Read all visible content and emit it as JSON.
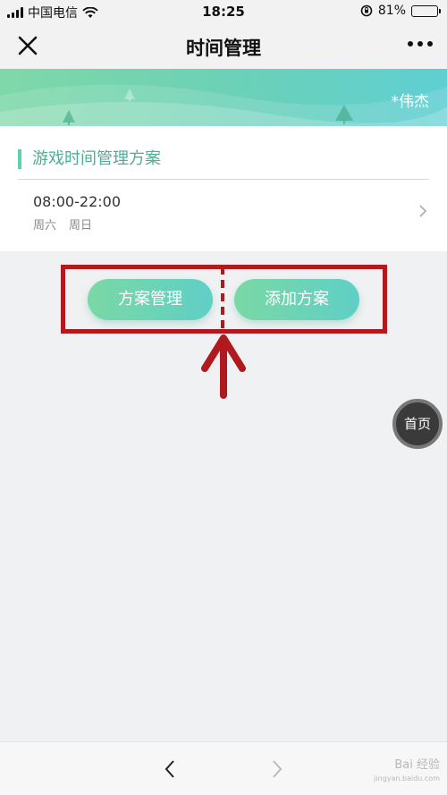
{
  "status_bar": {
    "carrier": "中国电信",
    "time": "18:25",
    "battery": "81%",
    "battery_level": 0.81,
    "icons": [
      "signal-icon",
      "wifi-icon",
      "rotation-lock-icon",
      "battery-icon"
    ]
  },
  "nav": {
    "title": "时间管理",
    "close_icon": "close-icon",
    "more_icon": "more-icon"
  },
  "banner": {
    "user": "*伟杰"
  },
  "section": {
    "title": "游戏时间管理方案"
  },
  "plans": [
    {
      "time": "08:00-22:00",
      "days": [
        "周六",
        "周日"
      ]
    }
  ],
  "buttons": {
    "manage": "方案管理",
    "add": "添加方案"
  },
  "fab": {
    "home": "首页"
  },
  "watermark": {
    "line1": "Bai 经验",
    "line2": "jingyan.baidu.com"
  },
  "colors": {
    "accent": "#5ed1ad",
    "section_title": "#4cae94",
    "annotation_red": "#b0191e",
    "fab_bg": "#3a3a3a"
  }
}
